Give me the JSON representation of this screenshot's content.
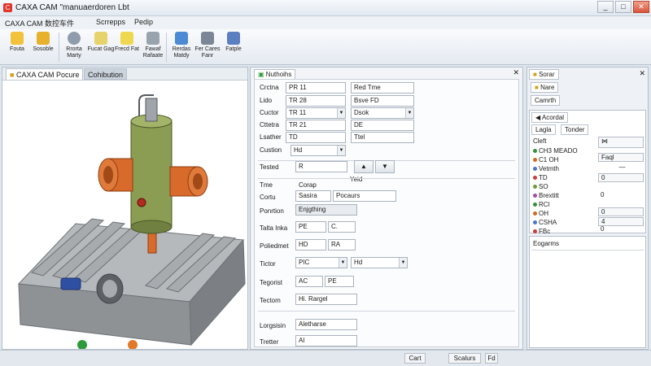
{
  "window": {
    "title": "CAXA CAM \"manuaerdoren Lbt",
    "minimize_label": "_",
    "maximize_label": "□",
    "close_label": "✕",
    "app_icon_glyph": "C"
  },
  "menu": [
    "CAXA CAM 数控车件",
    "Scrrepps",
    "Pedip"
  ],
  "ribbon": [
    {
      "label": "Fouta",
      "icon": "folder-open-icon",
      "color": "#f2c23a"
    },
    {
      "label": "Sosoble",
      "icon": "cube-icon",
      "color": "#e8b12c"
    },
    {
      "label": "Rrorta Marty",
      "icon": "globe-icon",
      "color": "#8f9cab"
    },
    {
      "label": "Fucat Gag",
      "icon": "document-icon",
      "color": "#e6d36b"
    },
    {
      "label": "Frecd Fat",
      "icon": "document-yellow-icon",
      "color": "#f0d84e"
    },
    {
      "label": "Fawaf Rafaate",
      "icon": "printer-icon",
      "color": "#98a3ad"
    },
    {
      "label": "Rerdas Matdy",
      "icon": "bottle-icon",
      "color": "#4c8bd4"
    },
    {
      "label": "Fer Cares Fanr",
      "icon": "card-icon",
      "color": "#7b8796"
    },
    {
      "label": "Fatple",
      "icon": "gear-cube-icon",
      "color": "#5b7fc0"
    }
  ],
  "viewport": {
    "tab_active": "CAXA CAM Pocure",
    "tab_inactive": "Cohibution",
    "colors": {
      "body": "#8a9d52",
      "nozzle": "#d86a2b",
      "base": "#9a9ea2"
    }
  },
  "dialog": {
    "tab": "Nuthoihs",
    "close_label": "✕",
    "rows": [
      {
        "label": "Crctna",
        "v1": "PR 11",
        "v2": "Red Tme"
      },
      {
        "label": "Lido",
        "v1": "TR 28",
        "v2": "Bsve FD"
      },
      {
        "label": "Cuctor",
        "v1": "TR 11",
        "v2": "Dsok"
      },
      {
        "label": "Cttetra",
        "v1": "TR 21",
        "v2": "DE"
      },
      {
        "label": "Lsather",
        "v1": "TD",
        "v2": "Ttel"
      }
    ],
    "cushion": {
      "label": "Custion",
      "value": "Hd"
    },
    "tested": {
      "label": "Tested",
      "value": "R"
    },
    "spin_up": "▲",
    "spin_down": "▼",
    "yield_label": "Yeid",
    "sect_label": "Tme",
    "sect_value": "Corap",
    "rows2": [
      {
        "label": "Cortu",
        "v1": "Sasira",
        "v2": "Pocaurs"
      },
      {
        "label": "Ponrtion",
        "v1": "Enjgthing",
        "v2": ""
      },
      {
        "label": "Talta Inka",
        "v1": "PE",
        "v2": "C."
      },
      {
        "label": "Poliedmet",
        "v1": "HD",
        "v2": "RA"
      },
      {
        "label": "Tictor",
        "v1": "PIC",
        "v2": "Hd"
      },
      {
        "label": "Tegorist",
        "v1": "AC",
        "v2": "PE"
      },
      {
        "label": "Tectom",
        "v1": "Hi. Rargel",
        "v2": ""
      },
      {
        "label": "Lorgsisin",
        "v1": "Aletharse",
        "v2": ""
      },
      {
        "label": "Tretter",
        "v1": "Al",
        "v2": ""
      }
    ]
  },
  "right_panel": {
    "close_label": "✕",
    "tab1": "Sorar",
    "tab2": "Nare",
    "tab3": "Camrth",
    "panel_tab": "Acordal",
    "sub_tabs": [
      "Lagla",
      "Tonder"
    ],
    "tree_header": "Cleft",
    "tree": [
      {
        "label": "CH3 MEADO",
        "color": "#3a8f3a",
        "value": ""
      },
      {
        "label": "C1 OH",
        "color": "#d06a20",
        "value": "Faql"
      },
      {
        "label": "Vetmth",
        "color": "#4977c9",
        "value": "—"
      },
      {
        "label": "TD",
        "color": "#cf3a3a",
        "value": "0"
      },
      {
        "label": "SO",
        "color": "#6a9c3d",
        "value": ""
      },
      {
        "label": "Brextitt",
        "color": "#a84aa8",
        "value": "0"
      },
      {
        "label": "RCl",
        "color": "#3a8f3a",
        "value": ""
      },
      {
        "label": "OH",
        "color": "#d06a20",
        "value": "0"
      },
      {
        "label": "CSHA",
        "color": "#4977c9",
        "value": "4"
      },
      {
        "label": "FBc",
        "color": "#cf3a3a",
        "value": "0"
      }
    ],
    "sub_header": "Eogarms"
  },
  "status": {
    "ok": "Cart",
    "mid": "Scalurs",
    "end": "Fd"
  }
}
